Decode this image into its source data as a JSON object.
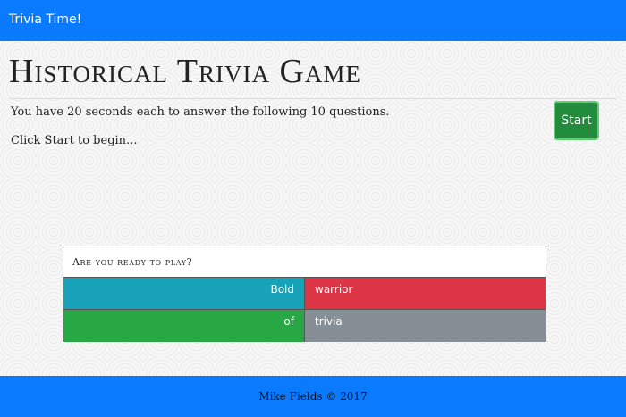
{
  "navbar": {
    "brand": "Trivia Time!"
  },
  "main": {
    "title": "Historical Trivia Game",
    "instructions": "You have 20 seconds each to answer the following 10 questions.",
    "start_hint": "Click Start to begin...",
    "start_button_label": "Start"
  },
  "quiz": {
    "question": "Are you ready to play?",
    "answers": [
      {
        "label": "Bold",
        "color": "#17a2b8"
      },
      {
        "label": "warrior",
        "color": "#dc3545"
      },
      {
        "label": "of",
        "color": "#28a745"
      },
      {
        "label": "trivia",
        "color": "#868e96"
      }
    ]
  },
  "footer": {
    "text": "Mike Fields © 2017"
  },
  "colors": {
    "navbar": "#0a7bff",
    "start_button": "#228b3c"
  }
}
